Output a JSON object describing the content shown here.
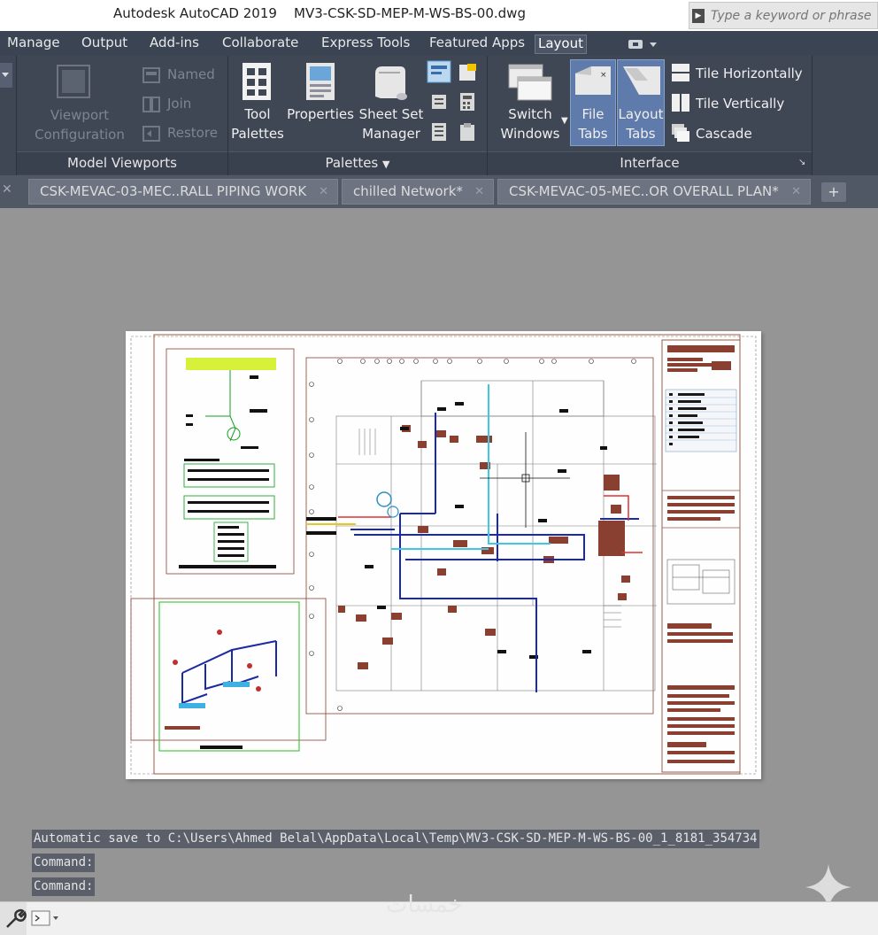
{
  "titlebar": {
    "app_name": "Autodesk AutoCAD 2019",
    "document_name": "MV3-CSK-SD-MEP-M-WS-BS-00.dwg",
    "search_placeholder": "Type a keyword or phrase"
  },
  "ribbon_tabs": [
    "Manage",
    "Output",
    "Add-ins",
    "Collaborate",
    "Express Tools",
    "Featured Apps",
    "Layout"
  ],
  "active_ribbon_tab": "Layout",
  "ribbon": {
    "model_viewports": {
      "title": "Model Viewports",
      "viewport_configuration": "Viewport Configuration",
      "named": "Named",
      "join": "Join",
      "restore": "Restore"
    },
    "palettes": {
      "title": "Palettes",
      "tool_palettes": "Tool Palettes",
      "properties": "Properties",
      "sheet_set_manager": "Sheet Set Manager"
    },
    "interface": {
      "title": "Interface",
      "switch_windows": "Switch Windows",
      "file_tabs": "File Tabs",
      "layout_tabs": "Layout Tabs",
      "tile_horizontally": "Tile Horizontally",
      "tile_vertically": "Tile Vertically",
      "cascade": "Cascade"
    }
  },
  "file_tabs": [
    {
      "label": "CSK-MEVAC-03-MEC..RALL PIPING WORK"
    },
    {
      "label": "chilled Network*"
    },
    {
      "label": "CSK-MEVAC-05-MEC..OR OVERALL PLAN*"
    }
  ],
  "command_history": [
    "Automatic save to C:\\Users\\Ahmed Belal\\AppData\\Local\\Temp\\MV3-CSK-SD-MEP-M-WS-BS-00_1_8181_354734",
    "Command:",
    "Command:"
  ],
  "watermark": "خمسات",
  "colors": {
    "ribbon_bg": "#3f4654",
    "tabs_bg": "#3b4453",
    "canvas_bg": "#959595",
    "active_toggle": "#5f7bab"
  }
}
